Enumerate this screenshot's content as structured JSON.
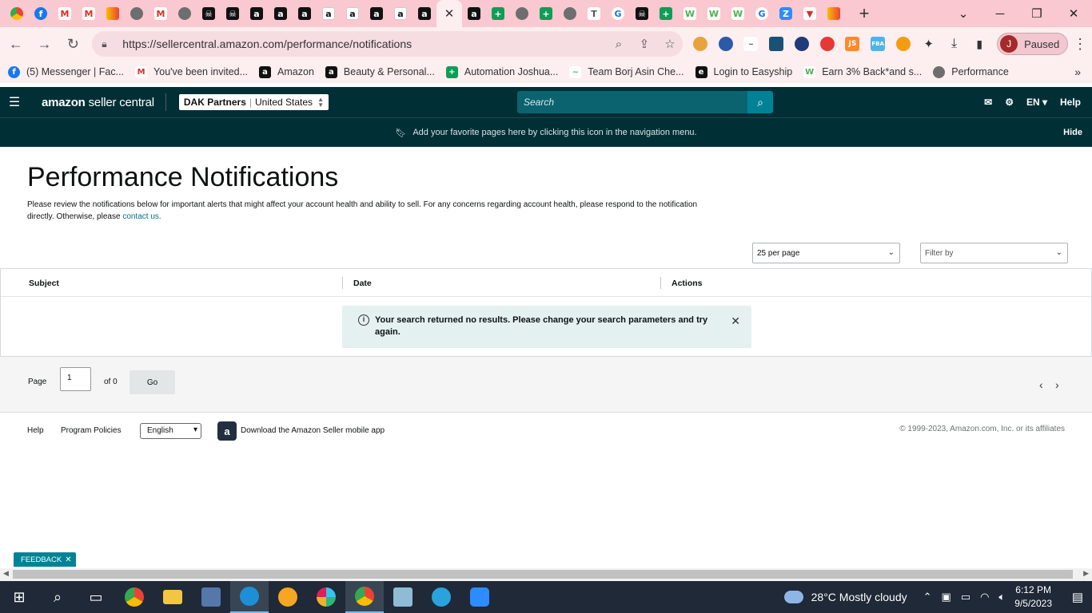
{
  "browser": {
    "active_tab_close": "✕",
    "new_tab": "+",
    "window": {
      "minimize": "─",
      "maximize": "❐",
      "close": "✕",
      "tab_search": "⌄"
    },
    "url": "https://sellercentral.amazon.com/performance/notifications",
    "profile_initial": "J",
    "profile_status": "Paused",
    "bookmarks": [
      {
        "label": "(5) Messenger | Fac...",
        "icon": "facebook-icon"
      },
      {
        "label": "You've been invited...",
        "icon": "gmail-icon"
      },
      {
        "label": "Amazon",
        "icon": "amazon-icon"
      },
      {
        "label": "Beauty & Personal...",
        "icon": "amazon-icon"
      },
      {
        "label": "Automation Joshua...",
        "icon": "sheets-icon"
      },
      {
        "label": "Team Borj Asin Che...",
        "icon": "tool-icon"
      },
      {
        "label": "Login to Easyship",
        "icon": "easyship-icon"
      },
      {
        "label": "Earn 3% Back*and s...",
        "icon": "w-icon"
      },
      {
        "label": "Performance",
        "icon": "globe-icon"
      }
    ],
    "bookmarks_more": "»"
  },
  "header": {
    "brand_prefix": "amazon",
    "brand_suffix": "seller central",
    "account": "DAK Partners",
    "marketplace": "United States",
    "search_placeholder": "Search",
    "language": "EN ▾",
    "help": "Help"
  },
  "favorites_bar": {
    "message": "Add your favorite pages here by clicking this icon in the navigation menu.",
    "hide": "Hide"
  },
  "main": {
    "title": "Performance Notifications",
    "description": "Please review the notifications below for important alerts that might affect your account health and ability to sell. For any concerns regarding account health, please respond to the notification directly. Otherwise, please ",
    "contact_link": "contact us.",
    "per_page": "25 per page",
    "filter": "Filter by",
    "columns": [
      "Subject",
      "Date",
      "Actions"
    ],
    "alert": "Your search returned no results. Please change your search parameters and try again."
  },
  "pager": {
    "page_label": "Page",
    "page_value": "1",
    "of_label": "of 0",
    "go": "Go",
    "prev": "‹",
    "next": "›"
  },
  "footer": {
    "help": "Help",
    "program_policies": "Program Policies",
    "language": "English",
    "app_text": "Download the Amazon Seller mobile app",
    "copyright": "© 1999-2023, Amazon.com, Inc. or its affiliates"
  },
  "feedback": "FEEDBACK",
  "taskbar": {
    "weather": "28°C  Mostly cloudy",
    "time": "6:12 PM",
    "date": "9/5/2023"
  }
}
